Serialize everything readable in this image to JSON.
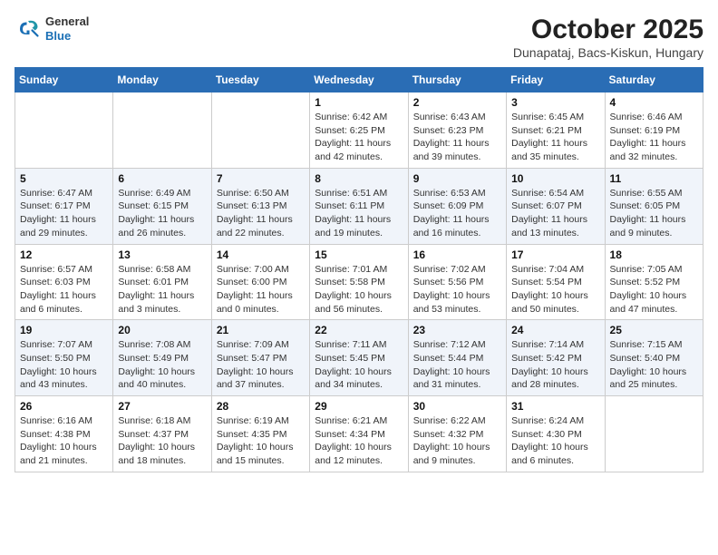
{
  "header": {
    "logo_general": "General",
    "logo_blue": "Blue",
    "month_title": "October 2025",
    "location": "Dunapataj, Bacs-Kiskun, Hungary"
  },
  "days_of_week": [
    "Sunday",
    "Monday",
    "Tuesday",
    "Wednesday",
    "Thursday",
    "Friday",
    "Saturday"
  ],
  "weeks": [
    [
      {
        "day": "",
        "info": ""
      },
      {
        "day": "",
        "info": ""
      },
      {
        "day": "",
        "info": ""
      },
      {
        "day": "1",
        "info": "Sunrise: 6:42 AM\nSunset: 6:25 PM\nDaylight: 11 hours\nand 42 minutes."
      },
      {
        "day": "2",
        "info": "Sunrise: 6:43 AM\nSunset: 6:23 PM\nDaylight: 11 hours\nand 39 minutes."
      },
      {
        "day": "3",
        "info": "Sunrise: 6:45 AM\nSunset: 6:21 PM\nDaylight: 11 hours\nand 35 minutes."
      },
      {
        "day": "4",
        "info": "Sunrise: 6:46 AM\nSunset: 6:19 PM\nDaylight: 11 hours\nand 32 minutes."
      }
    ],
    [
      {
        "day": "5",
        "info": "Sunrise: 6:47 AM\nSunset: 6:17 PM\nDaylight: 11 hours\nand 29 minutes."
      },
      {
        "day": "6",
        "info": "Sunrise: 6:49 AM\nSunset: 6:15 PM\nDaylight: 11 hours\nand 26 minutes."
      },
      {
        "day": "7",
        "info": "Sunrise: 6:50 AM\nSunset: 6:13 PM\nDaylight: 11 hours\nand 22 minutes."
      },
      {
        "day": "8",
        "info": "Sunrise: 6:51 AM\nSunset: 6:11 PM\nDaylight: 11 hours\nand 19 minutes."
      },
      {
        "day": "9",
        "info": "Sunrise: 6:53 AM\nSunset: 6:09 PM\nDaylight: 11 hours\nand 16 minutes."
      },
      {
        "day": "10",
        "info": "Sunrise: 6:54 AM\nSunset: 6:07 PM\nDaylight: 11 hours\nand 13 minutes."
      },
      {
        "day": "11",
        "info": "Sunrise: 6:55 AM\nSunset: 6:05 PM\nDaylight: 11 hours\nand 9 minutes."
      }
    ],
    [
      {
        "day": "12",
        "info": "Sunrise: 6:57 AM\nSunset: 6:03 PM\nDaylight: 11 hours\nand 6 minutes."
      },
      {
        "day": "13",
        "info": "Sunrise: 6:58 AM\nSunset: 6:01 PM\nDaylight: 11 hours\nand 3 minutes."
      },
      {
        "day": "14",
        "info": "Sunrise: 7:00 AM\nSunset: 6:00 PM\nDaylight: 11 hours\nand 0 minutes."
      },
      {
        "day": "15",
        "info": "Sunrise: 7:01 AM\nSunset: 5:58 PM\nDaylight: 10 hours\nand 56 minutes."
      },
      {
        "day": "16",
        "info": "Sunrise: 7:02 AM\nSunset: 5:56 PM\nDaylight: 10 hours\nand 53 minutes."
      },
      {
        "day": "17",
        "info": "Sunrise: 7:04 AM\nSunset: 5:54 PM\nDaylight: 10 hours\nand 50 minutes."
      },
      {
        "day": "18",
        "info": "Sunrise: 7:05 AM\nSunset: 5:52 PM\nDaylight: 10 hours\nand 47 minutes."
      }
    ],
    [
      {
        "day": "19",
        "info": "Sunrise: 7:07 AM\nSunset: 5:50 PM\nDaylight: 10 hours\nand 43 minutes."
      },
      {
        "day": "20",
        "info": "Sunrise: 7:08 AM\nSunset: 5:49 PM\nDaylight: 10 hours\nand 40 minutes."
      },
      {
        "day": "21",
        "info": "Sunrise: 7:09 AM\nSunset: 5:47 PM\nDaylight: 10 hours\nand 37 minutes."
      },
      {
        "day": "22",
        "info": "Sunrise: 7:11 AM\nSunset: 5:45 PM\nDaylight: 10 hours\nand 34 minutes."
      },
      {
        "day": "23",
        "info": "Sunrise: 7:12 AM\nSunset: 5:44 PM\nDaylight: 10 hours\nand 31 minutes."
      },
      {
        "day": "24",
        "info": "Sunrise: 7:14 AM\nSunset: 5:42 PM\nDaylight: 10 hours\nand 28 minutes."
      },
      {
        "day": "25",
        "info": "Sunrise: 7:15 AM\nSunset: 5:40 PM\nDaylight: 10 hours\nand 25 minutes."
      }
    ],
    [
      {
        "day": "26",
        "info": "Sunrise: 6:16 AM\nSunset: 4:38 PM\nDaylight: 10 hours\nand 21 minutes."
      },
      {
        "day": "27",
        "info": "Sunrise: 6:18 AM\nSunset: 4:37 PM\nDaylight: 10 hours\nand 18 minutes."
      },
      {
        "day": "28",
        "info": "Sunrise: 6:19 AM\nSunset: 4:35 PM\nDaylight: 10 hours\nand 15 minutes."
      },
      {
        "day": "29",
        "info": "Sunrise: 6:21 AM\nSunset: 4:34 PM\nDaylight: 10 hours\nand 12 minutes."
      },
      {
        "day": "30",
        "info": "Sunrise: 6:22 AM\nSunset: 4:32 PM\nDaylight: 10 hours\nand 9 minutes."
      },
      {
        "day": "31",
        "info": "Sunrise: 6:24 AM\nSunset: 4:30 PM\nDaylight: 10 hours\nand 6 minutes."
      },
      {
        "day": "",
        "info": ""
      }
    ]
  ]
}
